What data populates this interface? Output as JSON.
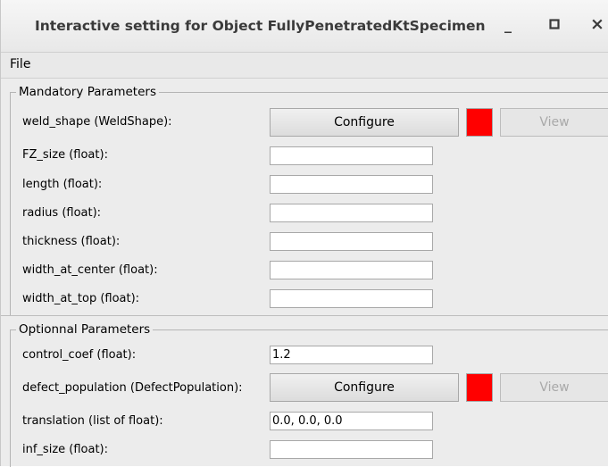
{
  "window": {
    "title": "Interactive setting for Object FullyPenetratedKtSpecimen",
    "minimize_glyph": "_",
    "maximize_glyph": "□",
    "close_glyph": "×"
  },
  "menubar": {
    "file_label": "File"
  },
  "mandatory": {
    "legend": "Mandatory Parameters",
    "weld_shape": {
      "label": "weld_shape (WeldShape):",
      "configure_label": "Configure",
      "color": "#ff0000",
      "view_label": "View"
    },
    "fields": [
      {
        "label": "FZ_size (float):",
        "value": ""
      },
      {
        "label": "length (float):",
        "value": ""
      },
      {
        "label": "radius (float):",
        "value": ""
      },
      {
        "label": "thickness (float):",
        "value": ""
      },
      {
        "label": "width_at_center (float):",
        "value": ""
      },
      {
        "label": "width_at_top (float):",
        "value": ""
      }
    ]
  },
  "optional": {
    "legend": "Optionnal Parameters",
    "control_coef": {
      "label": "control_coef (float):",
      "value": "1.2"
    },
    "defect_population": {
      "label": "defect_population (DefectPopulation):",
      "configure_label": "Configure",
      "color": "#ff0000",
      "view_label": "View"
    },
    "translation": {
      "label": "translation (list of float):",
      "value": "0.0, 0.0, 0.0"
    },
    "inf_size": {
      "label": "inf_size (float):",
      "value": ""
    }
  },
  "colors": {
    "indicator_red": "#ff0000",
    "window_bg": "#ececec"
  }
}
